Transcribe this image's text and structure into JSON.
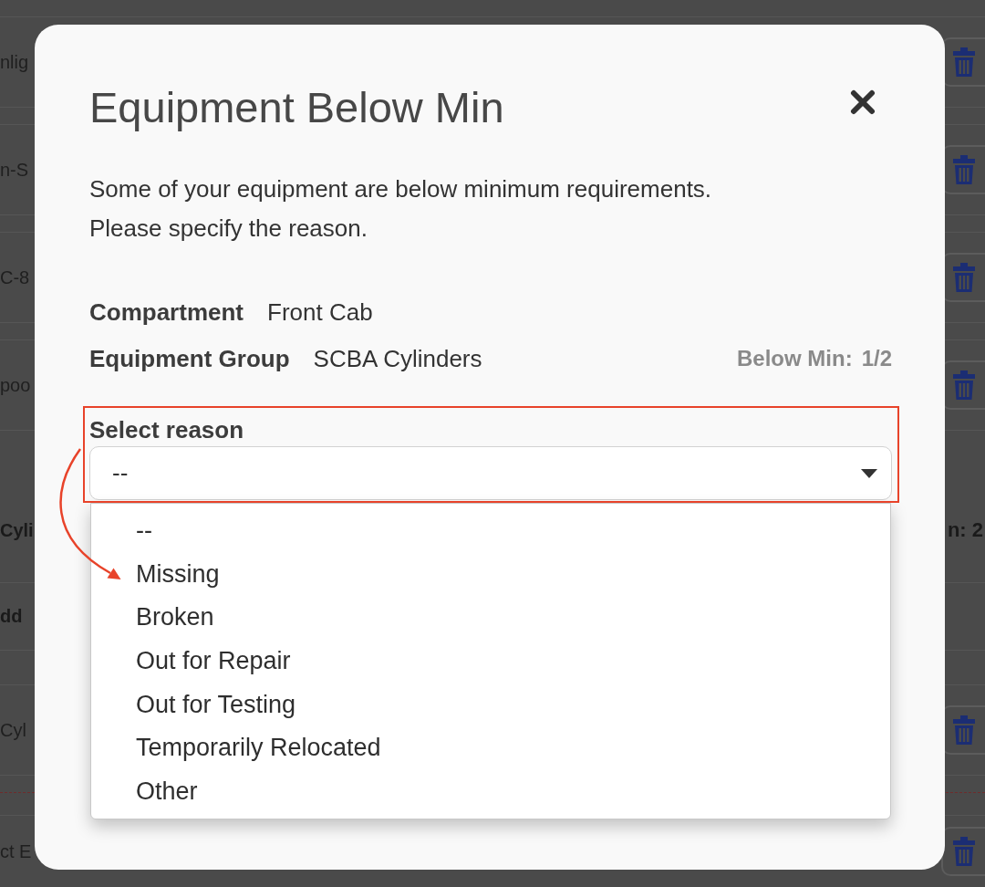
{
  "background_page": {
    "rows": [
      {
        "kind": "item",
        "text": "nlig"
      },
      {
        "kind": "item",
        "text": "n-S"
      },
      {
        "kind": "item",
        "text": "C-8"
      },
      {
        "kind": "item",
        "text": "poo"
      },
      {
        "kind": "header",
        "text": "Cyli",
        "suffix": "n: 2"
      },
      {
        "kind": "add",
        "text": "dd"
      },
      {
        "kind": "item",
        "text": "Cyl"
      },
      {
        "kind": "field",
        "text": "ct E"
      }
    ]
  },
  "dialog": {
    "title": "Equipment Below Min",
    "message": [
      "Some of your equipment are below minimum requirements.",
      "Please specify the reason."
    ],
    "details": [
      {
        "label": "Compartment",
        "value": "Front Cab"
      },
      {
        "label": "Equipment Group",
        "value": "SCBA Cylinders"
      }
    ],
    "below_min": {
      "label": "Below Min:",
      "value": "1/2"
    },
    "reason": {
      "label": "Select reason",
      "value": "--",
      "expanded": true,
      "options": [
        "--",
        "Missing",
        "Broken",
        "Out for Repair",
        "Out for Testing",
        "Temporarily Relocated",
        "Other"
      ]
    }
  }
}
